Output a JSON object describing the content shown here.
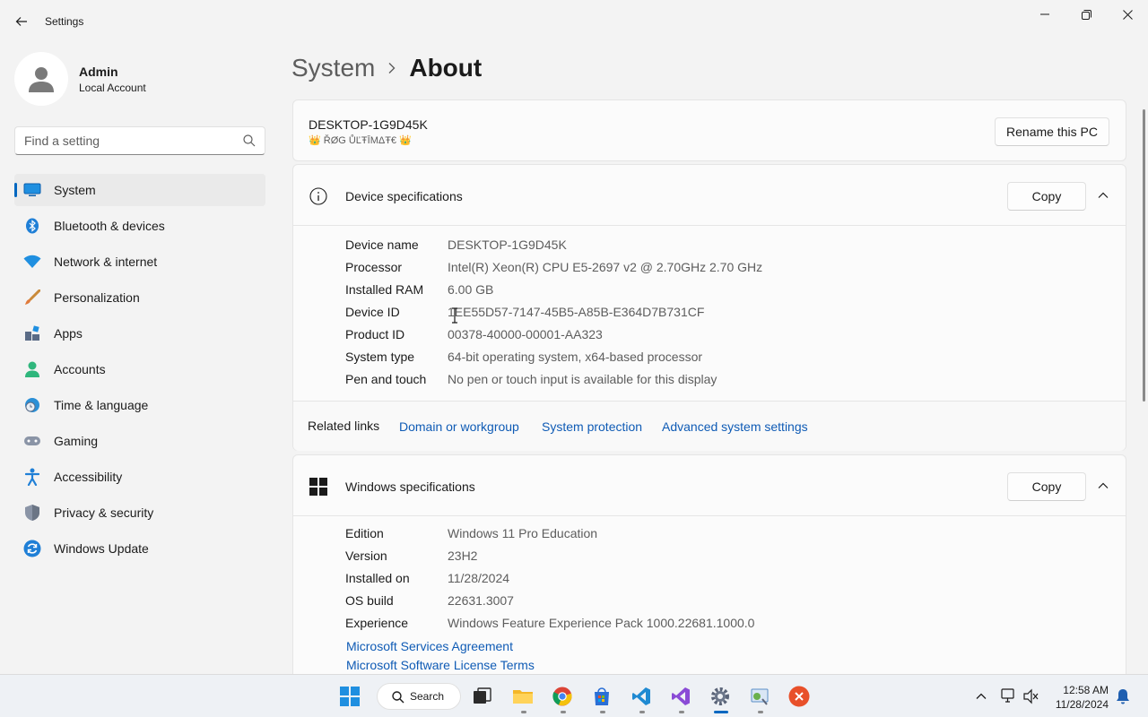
{
  "app": {
    "title": "Settings",
    "colors": {
      "accent": "#0067c0",
      "link": "#0f5bb5",
      "background": "#f3f3f3",
      "card": "#fbfbfb"
    }
  },
  "window_controls": [
    "minimize-icon",
    "restore-icon",
    "close-icon"
  ],
  "profile": {
    "name": "Admin",
    "account_type": "Local Account"
  },
  "search": {
    "placeholder": "Find a setting"
  },
  "nav": {
    "items": [
      {
        "label": "System",
        "icon": "monitor-icon",
        "active": true
      },
      {
        "label": "Bluetooth & devices",
        "icon": "bluetooth-icon"
      },
      {
        "label": "Network & internet",
        "icon": "wifi-icon"
      },
      {
        "label": "Personalization",
        "icon": "brush-icon"
      },
      {
        "label": "Apps",
        "icon": "apps-icon"
      },
      {
        "label": "Accounts",
        "icon": "person-icon"
      },
      {
        "label": "Time & language",
        "icon": "globe-clock-icon"
      },
      {
        "label": "Gaming",
        "icon": "gamepad-icon"
      },
      {
        "label": "Accessibility",
        "icon": "accessibility-icon"
      },
      {
        "label": "Privacy & security",
        "icon": "shield-icon"
      },
      {
        "label": "Windows Update",
        "icon": "update-icon"
      }
    ]
  },
  "breadcrumb": {
    "parent": "System",
    "current": "About"
  },
  "pc": {
    "name": "DESKTOP-1G9D45K",
    "subtitle": "👑 ŘØG ŮĽŦĪMΔŦ€ 👑",
    "rename_label": "Rename this PC"
  },
  "device_specs": {
    "title": "Device specifications",
    "copy_label": "Copy",
    "rows": [
      {
        "key": "Device name",
        "value": "DESKTOP-1G9D45K"
      },
      {
        "key": "Processor",
        "value": "Intel(R) Xeon(R) CPU E5-2697 v2 @ 2.70GHz   2.70 GHz"
      },
      {
        "key": "Installed RAM",
        "value": "6.00 GB"
      },
      {
        "key": "Device ID",
        "value": "1EE55D57-7147-45B5-A85B-E364D7B731CF"
      },
      {
        "key": "Product ID",
        "value": "00378-40000-00001-AA323"
      },
      {
        "key": "System type",
        "value": "64-bit operating system, x64-based processor"
      },
      {
        "key": "Pen and touch",
        "value": "No pen or touch input is available for this display"
      }
    ],
    "related_label": "Related links",
    "related_links": [
      "Domain or workgroup",
      "System protection",
      "Advanced system settings"
    ]
  },
  "windows_specs": {
    "title": "Windows specifications",
    "copy_label": "Copy",
    "rows": [
      {
        "key": "Edition",
        "value": "Windows 11 Pro Education"
      },
      {
        "key": "Version",
        "value": "23H2"
      },
      {
        "key": "Installed on",
        "value": "11/28/2024"
      },
      {
        "key": "OS build",
        "value": "22631.3007"
      },
      {
        "key": "Experience",
        "value": "Windows Feature Experience Pack 1000.22681.1000.0"
      }
    ],
    "links": [
      "Microsoft Services Agreement",
      "Microsoft Software License Terms"
    ]
  },
  "taskbar": {
    "search_label": "Search",
    "apps": [
      "windows-start-icon",
      "task-view-icon",
      "file-explorer-icon",
      "chrome-icon",
      "store-icon",
      "vscode-icon",
      "visual-studio-icon",
      "settings-icon",
      "control-panel-icon",
      "close-app-icon"
    ],
    "time": "12:58 AM",
    "date": "11/28/2024"
  }
}
